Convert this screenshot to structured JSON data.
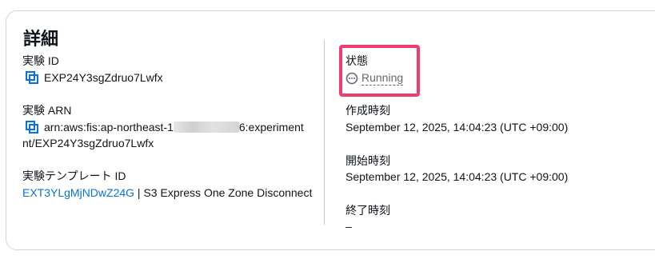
{
  "panel": {
    "title": "詳細"
  },
  "left": {
    "experiment_id": {
      "label": "実験 ID",
      "value": "EXP24Y3sgZdruo7Lwfx"
    },
    "experiment_arn": {
      "label": "実験 ARN",
      "line1_prefix": "arn:aws:fis:ap-northeast-1",
      "line1_suffix": "6:experiment",
      "line2": "nt/EXP24Y3sgZdruo7Lwfx"
    },
    "template_id": {
      "label": "実験テンプレート ID",
      "link": "EXT3YLgMjNDwZ24G",
      "separator": " | ",
      "name": "S3 Express One Zone Disconnect"
    }
  },
  "right": {
    "state": {
      "label": "状態",
      "value": "Running",
      "icon": "in-progress-icon",
      "text_color": "#656871",
      "highlight_color": "#ef3b6e"
    },
    "created_time": {
      "label": "作成時刻",
      "value": "September 12, 2025, 14:04:23 (UTC +09:00)"
    },
    "start_time": {
      "label": "開始時刻",
      "value": "September 12, 2025, 14:04:23 (UTC +09:00)"
    },
    "end_time": {
      "label": "終了時刻",
      "value": "–"
    }
  },
  "colors": {
    "link": "#0972d3",
    "copy_icon": "#0972d3",
    "border": "#d1d5db"
  }
}
